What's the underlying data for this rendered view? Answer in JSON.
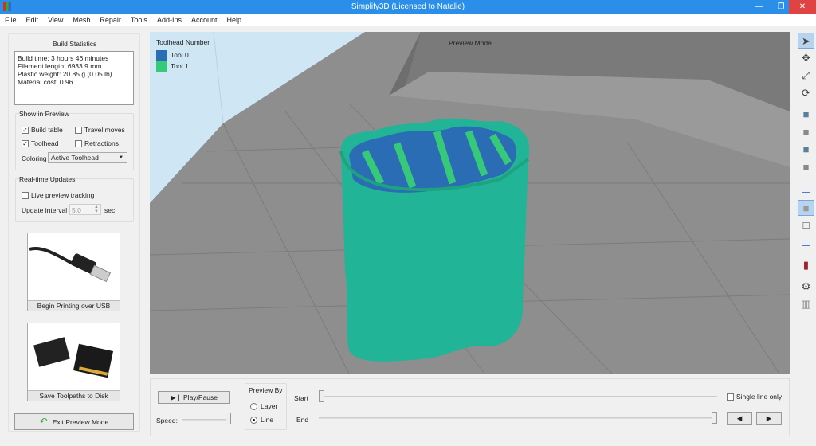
{
  "window": {
    "title": "Simplify3D (Licensed to Natalie)",
    "minimize": "—",
    "maximize": "❐",
    "close": "✕"
  },
  "menu": [
    "File",
    "Edit",
    "View",
    "Mesh",
    "Repair",
    "Tools",
    "Add-Ins",
    "Account",
    "Help"
  ],
  "build_statistics": {
    "title": "Build Statistics",
    "lines": [
      "Build time: 3 hours 46 minutes",
      "Filament length: 6933.9 mm",
      "Plastic weight: 20.85 g (0.05 lb)",
      "Material cost: 0.96"
    ]
  },
  "show_in_preview": {
    "title": "Show in Preview",
    "build_table": {
      "label": "Build table",
      "checked": true
    },
    "travel_moves": {
      "label": "Travel moves",
      "checked": false
    },
    "toolhead": {
      "label": "Toolhead",
      "checked": true
    },
    "retractions": {
      "label": "Retractions",
      "checked": false
    },
    "coloring_label": "Coloring",
    "coloring_value": "Active Toolhead"
  },
  "realtime": {
    "title": "Real-time Updates",
    "live_tracking": {
      "label": "Live preview tracking",
      "checked": false
    },
    "interval_label": "Update interval",
    "interval_value": "5.0",
    "interval_unit": "sec"
  },
  "usb_button": "Begin Printing over USB",
  "sd_button": "Save Toolpaths to Disk",
  "exit_button": "Exit Preview Mode",
  "viewport": {
    "mode_label": "Preview Mode",
    "legend_title": "Toolhead Number",
    "legend": [
      {
        "label": "Tool 0",
        "color": "#2a6db5"
      },
      {
        "label": "Tool 1",
        "color": "#37c97a"
      }
    ]
  },
  "controls": {
    "play_pause": "Play/Pause",
    "speed_label": "Speed:",
    "preview_by": "Preview By",
    "layer": "Layer",
    "line": "Line",
    "selected": "Line",
    "start_label": "Start",
    "end_label": "End",
    "single_line_only": "Single line only",
    "speed": 1.0,
    "start": 0.0,
    "end": 1.0
  },
  "toolbar": [
    "select-icon",
    "move-icon",
    "scale-icon",
    "rotate-icon",
    "view-default-icon",
    "view-front-icon",
    "view-top-icon",
    "view-side-icon",
    "axes-icon",
    "solid-view-icon",
    "wireframe-view-icon",
    "cross-section-icon",
    "section-color-icon",
    "settings-icon",
    "machine-icon"
  ]
}
